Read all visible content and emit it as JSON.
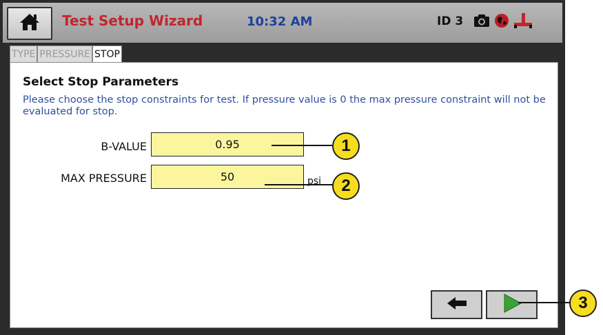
{
  "header": {
    "title": "Test Setup Wizard",
    "time": "10:32 AM",
    "device_id": "ID 3",
    "icons": [
      "home-icon",
      "camera-icon",
      "globe-icon",
      "network-icon"
    ],
    "colors": {
      "title": "#c2262c",
      "time": "#1e3f9e"
    }
  },
  "tabs": [
    {
      "label": "TYPE",
      "active": false
    },
    {
      "label": "PRESSURE",
      "active": false
    },
    {
      "label": "STOP",
      "active": true
    }
  ],
  "main": {
    "heading": "Select Stop Parameters",
    "description": "Please choose the stop constraints for test.  If pressure value is 0 the max pressure constraint will not be evaluated for stop.",
    "fields": [
      {
        "label": "B-VALUE",
        "value": "0.95",
        "unit": ""
      },
      {
        "label": "MAX PRESSURE",
        "value": "50",
        "unit": "psi"
      }
    ]
  },
  "nav": {
    "back_icon": "arrow-left-icon",
    "next_icon": "play-triangle-icon",
    "next_color": "#3aa335"
  },
  "callouts": [
    "1",
    "2",
    "3"
  ]
}
